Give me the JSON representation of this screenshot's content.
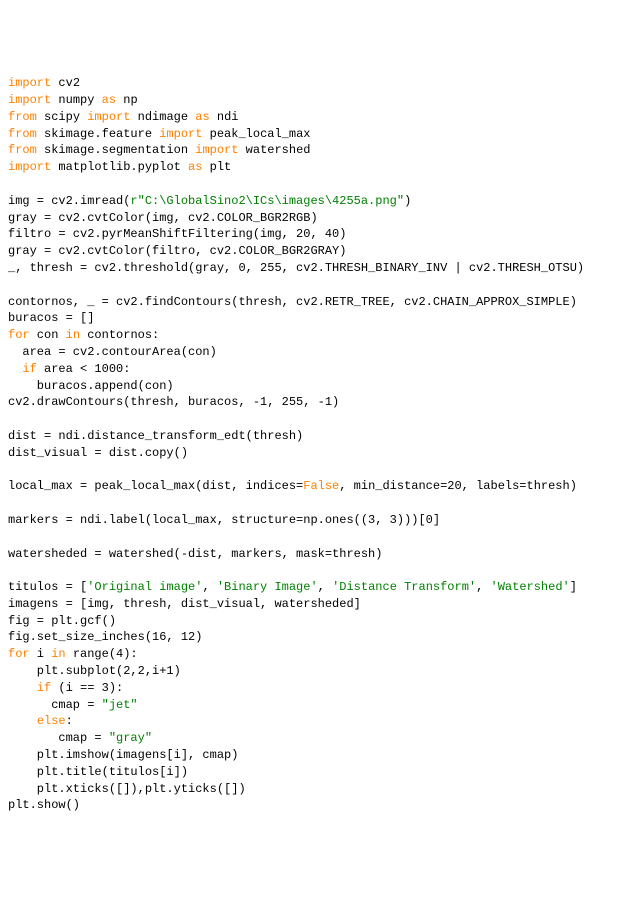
{
  "code_lines": [
    {
      "segments": [
        {
          "t": "import",
          "c": "kw"
        },
        {
          "t": " cv2",
          "c": "ident"
        }
      ]
    },
    {
      "segments": [
        {
          "t": "import",
          "c": "kw"
        },
        {
          "t": " numpy ",
          "c": "ident"
        },
        {
          "t": "as",
          "c": "kw"
        },
        {
          "t": " np",
          "c": "ident"
        }
      ]
    },
    {
      "segments": [
        {
          "t": "from",
          "c": "kw"
        },
        {
          "t": " scipy ",
          "c": "ident"
        },
        {
          "t": "import",
          "c": "kw"
        },
        {
          "t": " ndimage ",
          "c": "ident"
        },
        {
          "t": "as",
          "c": "kw"
        },
        {
          "t": " ndi",
          "c": "ident"
        }
      ]
    },
    {
      "segments": [
        {
          "t": "from",
          "c": "kw"
        },
        {
          "t": " skimage.feature ",
          "c": "ident"
        },
        {
          "t": "import",
          "c": "kw"
        },
        {
          "t": " peak_local_max",
          "c": "ident"
        }
      ]
    },
    {
      "segments": [
        {
          "t": "from",
          "c": "kw"
        },
        {
          "t": " skimage.segmentation ",
          "c": "ident"
        },
        {
          "t": "import",
          "c": "kw"
        },
        {
          "t": " watershed",
          "c": "ident"
        }
      ]
    },
    {
      "segments": [
        {
          "t": "import",
          "c": "kw"
        },
        {
          "t": " matplotlib.pyplot ",
          "c": "ident"
        },
        {
          "t": "as",
          "c": "kw"
        },
        {
          "t": " plt",
          "c": "ident"
        }
      ]
    },
    {
      "segments": [
        {
          "t": "",
          "c": "ident"
        }
      ]
    },
    {
      "segments": [
        {
          "t": "img = cv2.imread(",
          "c": "ident"
        },
        {
          "t": "r\"C:\\GlobalSino2\\ICs\\images\\4255a.png\"",
          "c": "str"
        },
        {
          "t": ")",
          "c": "ident"
        }
      ]
    },
    {
      "segments": [
        {
          "t": "gray = cv2.cvtColor(img, cv2.COLOR_BGR2RGB)",
          "c": "ident"
        }
      ]
    },
    {
      "segments": [
        {
          "t": "filtro = cv2.pyrMeanShiftFiltering(img, 20, 40)",
          "c": "ident"
        }
      ]
    },
    {
      "segments": [
        {
          "t": "gray = cv2.cvtColor(filtro, cv2.COLOR_BGR2GRAY)",
          "c": "ident"
        }
      ]
    },
    {
      "segments": [
        {
          "t": "_, thresh = cv2.threshold(gray, 0, 255, cv2.THRESH_BINARY_INV | cv2.THRESH_OTSU)",
          "c": "ident"
        }
      ]
    },
    {
      "segments": [
        {
          "t": "",
          "c": "ident"
        }
      ]
    },
    {
      "segments": [
        {
          "t": "contornos, _ = cv2.findContours(thresh, cv2.RETR_TREE, cv2.CHAIN_APPROX_SIMPLE)",
          "c": "ident"
        }
      ]
    },
    {
      "segments": [
        {
          "t": "buracos = []",
          "c": "ident"
        }
      ]
    },
    {
      "segments": [
        {
          "t": "for",
          "c": "kw"
        },
        {
          "t": " con ",
          "c": "ident"
        },
        {
          "t": "in",
          "c": "kw"
        },
        {
          "t": " contornos:",
          "c": "ident"
        }
      ]
    },
    {
      "segments": [
        {
          "t": "  area = cv2.contourArea(con)",
          "c": "ident"
        }
      ]
    },
    {
      "segments": [
        {
          "t": "  ",
          "c": "ident"
        },
        {
          "t": "if",
          "c": "kw"
        },
        {
          "t": " area < 1000:",
          "c": "ident"
        }
      ]
    },
    {
      "segments": [
        {
          "t": "    buracos.append(con)",
          "c": "ident"
        }
      ]
    },
    {
      "segments": [
        {
          "t": "cv2.drawContours(thresh, buracos, -1, 255, -1)",
          "c": "ident"
        }
      ]
    },
    {
      "segments": [
        {
          "t": "",
          "c": "ident"
        }
      ]
    },
    {
      "segments": [
        {
          "t": "dist = ndi.distance_transform_edt(thresh)",
          "c": "ident"
        }
      ]
    },
    {
      "segments": [
        {
          "t": "dist_visual = dist.copy()",
          "c": "ident"
        }
      ]
    },
    {
      "segments": [
        {
          "t": "",
          "c": "ident"
        }
      ]
    },
    {
      "segments": [
        {
          "t": "local_max = peak_local_max(dist, indices=",
          "c": "ident"
        },
        {
          "t": "False",
          "c": "const"
        },
        {
          "t": ", min_distance=20, labels=thresh)",
          "c": "ident"
        }
      ]
    },
    {
      "segments": [
        {
          "t": "",
          "c": "ident"
        }
      ]
    },
    {
      "segments": [
        {
          "t": "markers = ndi.label(local_max, structure=np.ones((3, 3)))[0]",
          "c": "ident"
        }
      ]
    },
    {
      "segments": [
        {
          "t": "",
          "c": "ident"
        }
      ]
    },
    {
      "segments": [
        {
          "t": "watersheded = watershed(-dist, markers, mask=thresh)",
          "c": "ident"
        }
      ]
    },
    {
      "segments": [
        {
          "t": "",
          "c": "ident"
        }
      ]
    },
    {
      "segments": [
        {
          "t": "titulos = [",
          "c": "ident"
        },
        {
          "t": "'Original image'",
          "c": "str"
        },
        {
          "t": ", ",
          "c": "ident"
        },
        {
          "t": "'Binary Image'",
          "c": "str"
        },
        {
          "t": ", ",
          "c": "ident"
        },
        {
          "t": "'Distance Transform'",
          "c": "str"
        },
        {
          "t": ", ",
          "c": "ident"
        },
        {
          "t": "'Watershed'",
          "c": "str"
        },
        {
          "t": "]",
          "c": "ident"
        }
      ]
    },
    {
      "segments": [
        {
          "t": "imagens = [img, thresh, dist_visual, watersheded]",
          "c": "ident"
        }
      ]
    },
    {
      "segments": [
        {
          "t": "fig = plt.gcf()",
          "c": "ident"
        }
      ]
    },
    {
      "segments": [
        {
          "t": "fig.set_size_inches(16, 12)",
          "c": "ident"
        }
      ]
    },
    {
      "segments": [
        {
          "t": "for",
          "c": "kw"
        },
        {
          "t": " i ",
          "c": "ident"
        },
        {
          "t": "in",
          "c": "kw"
        },
        {
          "t": " range(4):",
          "c": "ident"
        }
      ]
    },
    {
      "segments": [
        {
          "t": "    plt.subplot(2,2,i+1)",
          "c": "ident"
        }
      ]
    },
    {
      "segments": [
        {
          "t": "    ",
          "c": "ident"
        },
        {
          "t": "if",
          "c": "kw"
        },
        {
          "t": " (i == 3):",
          "c": "ident"
        }
      ]
    },
    {
      "segments": [
        {
          "t": "      cmap = ",
          "c": "ident"
        },
        {
          "t": "\"jet\"",
          "c": "str"
        }
      ]
    },
    {
      "segments": [
        {
          "t": "    ",
          "c": "ident"
        },
        {
          "t": "else",
          "c": "kw"
        },
        {
          "t": ":",
          "c": "ident"
        }
      ]
    },
    {
      "segments": [
        {
          "t": "       cmap = ",
          "c": "ident"
        },
        {
          "t": "\"gray\"",
          "c": "str"
        }
      ]
    },
    {
      "segments": [
        {
          "t": "    plt.imshow(imagens[i], cmap)",
          "c": "ident"
        }
      ]
    },
    {
      "segments": [
        {
          "t": "    plt.title(titulos[i])",
          "c": "ident"
        }
      ]
    },
    {
      "segments": [
        {
          "t": "    plt.xticks([]),plt.yticks([])",
          "c": "ident"
        }
      ]
    },
    {
      "segments": [
        {
          "t": "plt.show()",
          "c": "ident"
        }
      ]
    }
  ]
}
